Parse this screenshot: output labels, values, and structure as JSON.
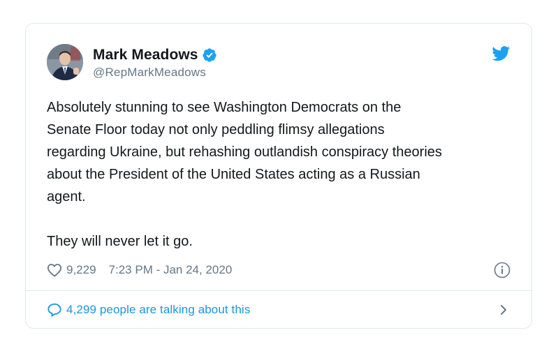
{
  "author": {
    "display_name": "Mark Meadows",
    "handle": "@RepMarkMeadows",
    "verified": true,
    "avatar_icon": "profile-photo"
  },
  "tweet": {
    "text": "Absolutely stunning to see Washington Democrats on the\nSenate Floor today not only peddling flimsy allegations\nregarding Ukraine, but rehashing outlandish conspiracy theories\nabout the President of the United States acting as a Russian\nagent.\n\nThey will never let it go."
  },
  "meta": {
    "likes": "9,229",
    "timestamp": "7:23 PM - Jan 24, 2020"
  },
  "footer": {
    "talking_text": "4,299 people are talking about this"
  },
  "icons": {
    "brand": "twitter-bird-icon",
    "verified": "verified-badge-icon",
    "like": "heart-icon",
    "info": "info-icon",
    "reply": "speech-bubble-icon",
    "expand": "chevron-right-icon"
  },
  "colors": {
    "twitter_blue": "#1da1f2",
    "link_blue": "#1b95e0",
    "text_primary": "#14171a",
    "text_secondary": "#657786",
    "border": "#e1e8ed"
  }
}
